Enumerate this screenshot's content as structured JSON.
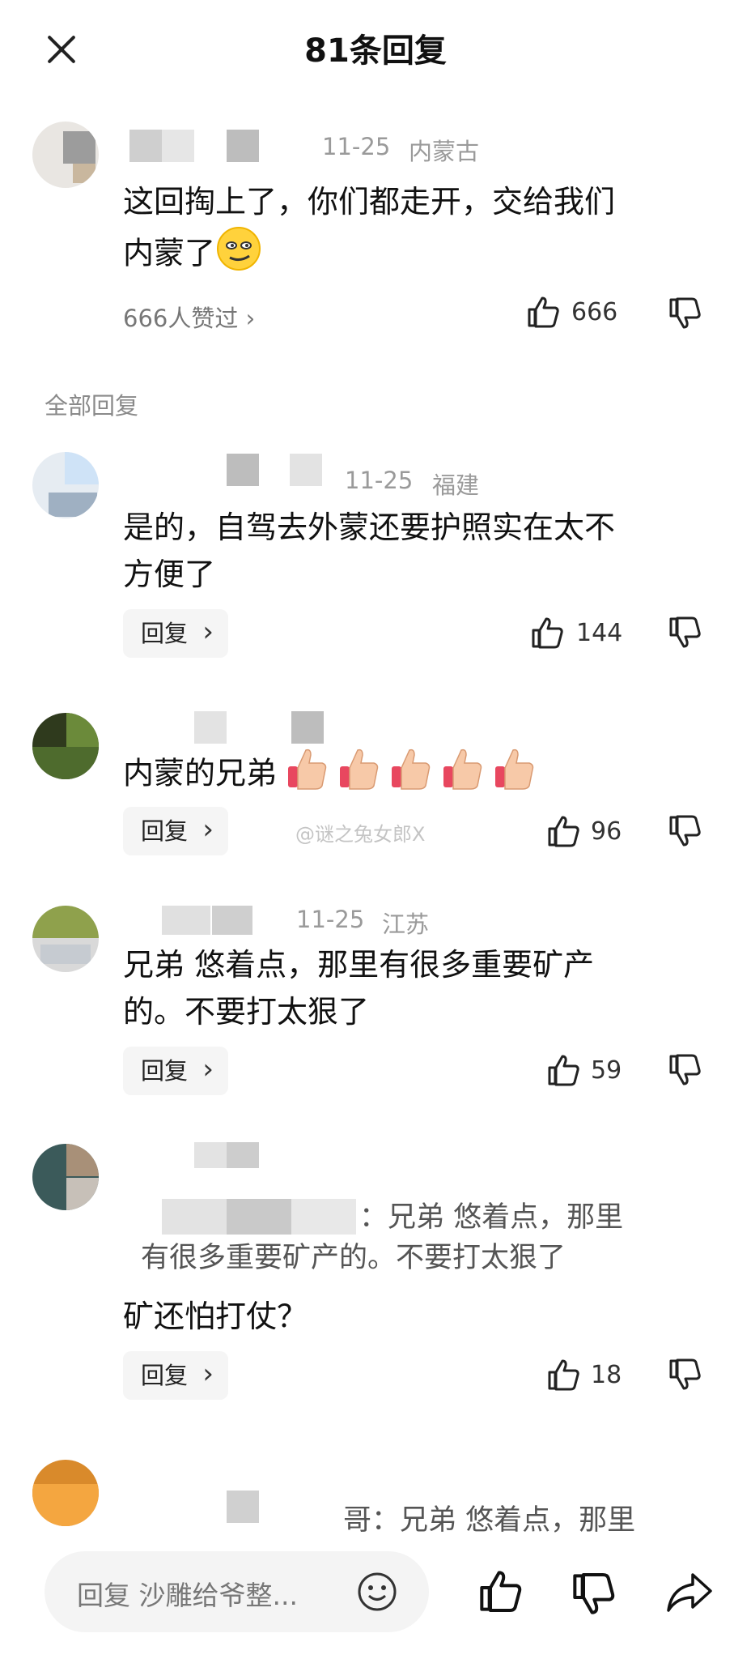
{
  "header": {
    "title": "81条回复"
  },
  "main_comment": {
    "date": "11-25",
    "location": "内蒙古",
    "text_line1": "这回掏上了，你们都走开，交给我们",
    "text_line2": "内蒙了",
    "likers": "666人赞过 ›",
    "like_count": "666"
  },
  "section_label": "全部回复",
  "replies": [
    {
      "date": "11-25",
      "location": "福建",
      "line1": "是的，自驾去外蒙还要护照实在太不",
      "line2": "方便了",
      "reply_label": "回复",
      "like_count": "144"
    },
    {
      "text": "内蒙的兄弟",
      "reply_label": "回复",
      "like_count": "96"
    },
    {
      "date": "11-25",
      "location": "江苏",
      "line1": "兄弟 悠着点，那里有很多重要矿产",
      "line2": "的。不要打太狠了",
      "reply_label": "回复",
      "like_count": "59"
    },
    {
      "quote1": "：兄弟 悠着点，那里",
      "quote2": "有很多重要矿产的。不要打太狠了",
      "text": "矿还怕打仗？",
      "reply_label": "回复",
      "like_count": "18"
    },
    {
      "quote1": "哥：兄弟 悠着点，那里"
    }
  ],
  "watermark": "@谜之兔女郎X",
  "bottom_bar": {
    "placeholder": "回复 沙雕给爷整..."
  }
}
